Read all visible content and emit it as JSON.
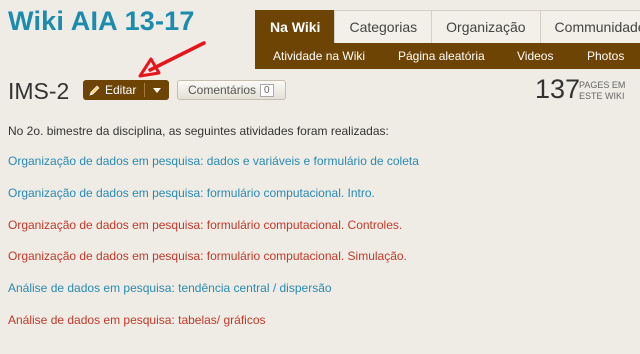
{
  "wiki_title": "Wiki AIA 13-17",
  "nav": {
    "tabs": [
      {
        "label": "Na Wiki",
        "active": true
      },
      {
        "label": "Categorias",
        "active": false
      },
      {
        "label": "Organização",
        "active": false
      },
      {
        "label": "Communidade",
        "active": false
      }
    ],
    "subnav": [
      "Atividade na Wiki",
      "Página aleatória",
      "Videos",
      "Photos"
    ]
  },
  "page": {
    "title": "IMS-2",
    "edit_label": "Editar",
    "comments_label": "Comentários",
    "comments_count": "0",
    "page_count": "137",
    "page_count_label": "PAGES EM ESTE WIKI"
  },
  "content": {
    "intro": "No 2o. bimestre da disciplina, as seguintes atividades foram realizadas:",
    "links": [
      {
        "text": "Organização de dados em pesquisa: dados e variáveis e formulário de coleta",
        "color": "#2a8ab3"
      },
      {
        "text": "Organização de dados em pesquisa: formulário computacional. Intro.",
        "color": "#2a8ab3"
      },
      {
        "text": "Organização de dados em pesquisa: formulário computacional. Controles.",
        "color": "#c0392b"
      },
      {
        "text": "Organização de dados em pesquisa: formulário computacional. Simulação.",
        "color": "#c0392b"
      },
      {
        "text": "Análise de dados em pesquisa: tendência central / dispersão",
        "color": "#2a8ab3"
      },
      {
        "text": "Análise de dados em pesquisa: tabelas/ gráficos",
        "color": "#c0392b"
      }
    ]
  },
  "colors": {
    "brand": "#1b8bae",
    "nav_active": "#6e4405",
    "annotation_arrow": "#e8141c"
  },
  "icons": [
    "pencil-icon",
    "chevron-down-icon",
    "arrow-annotation"
  ]
}
